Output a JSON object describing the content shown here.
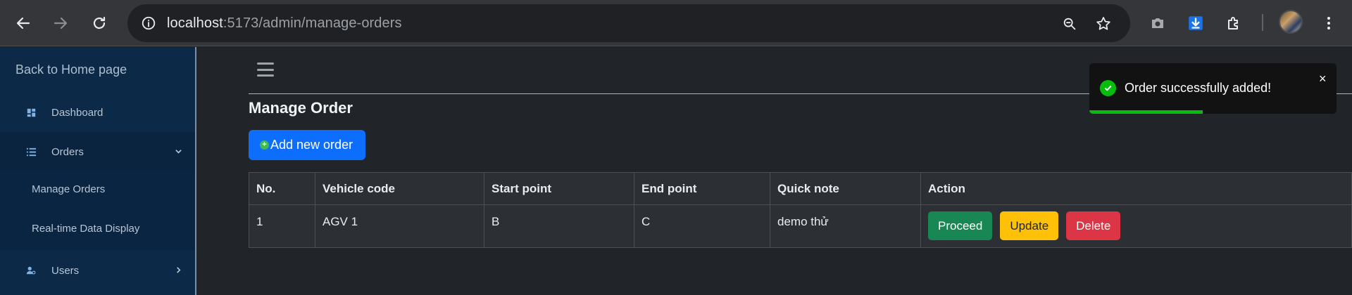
{
  "browser": {
    "url_host": "localhost",
    "url_path": ":5173/admin/manage-orders"
  },
  "sidebar": {
    "back_link": "Back to Home page",
    "items": [
      {
        "label": "Dashboard",
        "icon": "dashboard-icon"
      },
      {
        "label": "Orders",
        "icon": "list-icon",
        "expanded": true
      },
      {
        "label": "Users",
        "icon": "users-icon",
        "expanded": false
      }
    ],
    "sub_items": [
      {
        "label": "Manage Orders"
      },
      {
        "label": "Real-time Data Display"
      }
    ]
  },
  "main": {
    "title": "Manage Order",
    "add_button": "Add new order",
    "table": {
      "headers": [
        "No.",
        "Vehicle code",
        "Start point",
        "End point",
        "Quick note",
        "Action"
      ],
      "rows": [
        {
          "no": "1",
          "vehicle_code": "AGV 1",
          "start_point": "B",
          "end_point": "C",
          "quick_note": "demo thử"
        }
      ],
      "actions": {
        "proceed": "Proceed",
        "update": "Update",
        "delete": "Delete"
      }
    }
  },
  "toast": {
    "message": "Order successfully added!",
    "close": "×",
    "progress": 0.46,
    "color": "#07bc0c"
  },
  "colors": {
    "primary": "#0d6efd",
    "success": "#198754",
    "warning": "#ffc107",
    "danger": "#dc3545",
    "sidebar_bg": "#0c2a47"
  }
}
